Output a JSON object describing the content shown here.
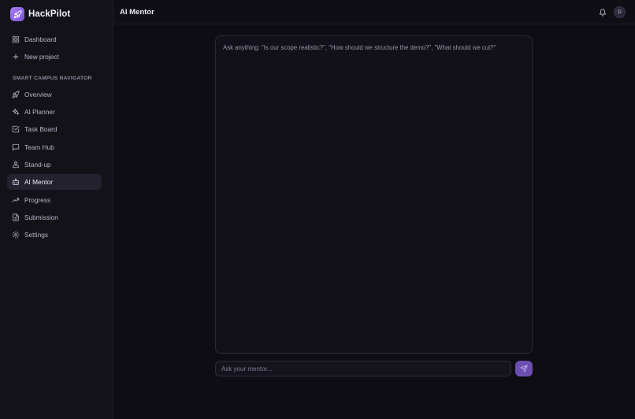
{
  "brand": {
    "name": "HackPilot",
    "logo_icon": "rocket-icon",
    "accent": "#8b64e6"
  },
  "sidebar": {
    "top_items": [
      {
        "label": "Dashboard",
        "icon": "grid-icon"
      },
      {
        "label": "New project",
        "icon": "plus-icon"
      }
    ],
    "section_label": "SMART CAMPUS NAVIGATOR",
    "project_items": [
      {
        "label": "Overview",
        "icon": "rocket-icon"
      },
      {
        "label": "AI Planner",
        "icon": "sparkles-icon"
      },
      {
        "label": "Task Board",
        "icon": "checkbox-icon"
      },
      {
        "label": "Team Hub",
        "icon": "chat-bubble-icon"
      },
      {
        "label": "Stand-up",
        "icon": "standup-icon"
      },
      {
        "label": "AI Mentor",
        "icon": "bot-icon",
        "active": true
      },
      {
        "label": "Progress",
        "icon": "trend-up-icon"
      },
      {
        "label": "Submission",
        "icon": "document-icon"
      },
      {
        "label": "Settings",
        "icon": "gear-icon"
      }
    ]
  },
  "header": {
    "title": "AI Mentor",
    "avatar_initial": "D",
    "notification_icon": "bell-icon"
  },
  "chat": {
    "empty_hint": "Ask anything: \"Is our scope realistic?\", \"How should we structure the demo?\", \"What should we cut?\""
  },
  "composer": {
    "placeholder": "Ask your mentor...",
    "send_icon": "send-icon",
    "send_color": "#6c4fb0"
  }
}
